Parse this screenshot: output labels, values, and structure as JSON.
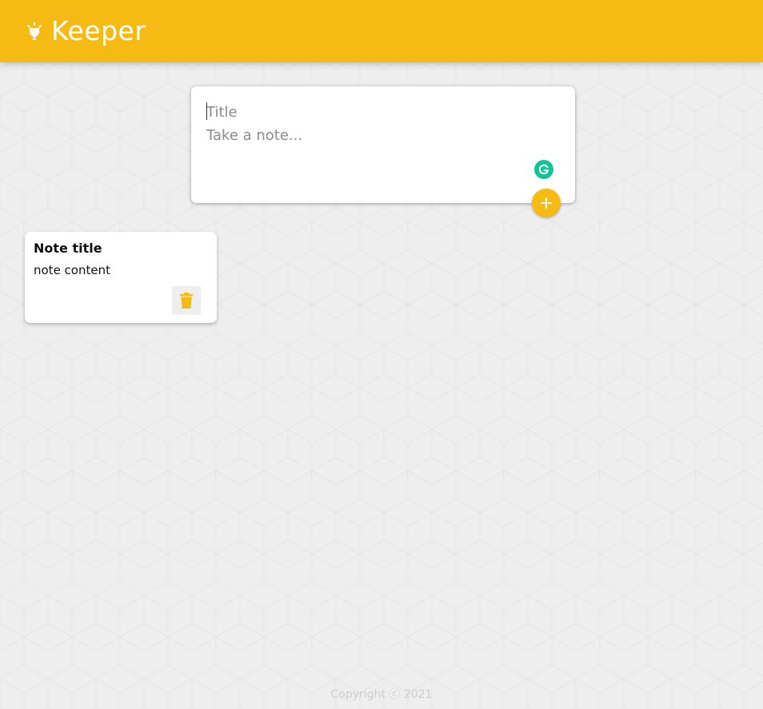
{
  "header": {
    "title": "Keeper",
    "logo_icon": "lightbulb-icon",
    "background_color": "#f5ba13"
  },
  "create_area": {
    "title_placeholder": "Title",
    "content_placeholder": "Take a note...",
    "title_value": "",
    "content_value": "",
    "add_icon": "plus-icon",
    "grammarly_icon": "grammarly-icon"
  },
  "notes": [
    {
      "title": "Note title",
      "content": "note content",
      "delete_icon": "trash-icon"
    }
  ],
  "footer": {
    "copyright": "Copyright ⓒ 2021"
  },
  "colors": {
    "accent": "#f5ba13",
    "background": "#eeeeee",
    "grammarly": "#15c39a"
  }
}
